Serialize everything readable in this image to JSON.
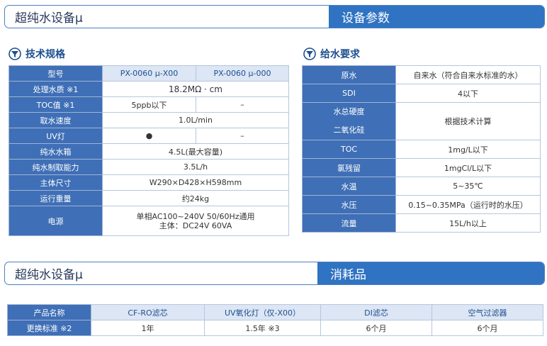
{
  "banner1": {
    "left": "超纯水设备μ",
    "right": "设备参数"
  },
  "spec": {
    "heading": "技术规格",
    "header": [
      "型号",
      "PX-0060 μ-X00",
      "PX-0060 μ-000"
    ],
    "rows": [
      {
        "label": "处理水质 ※1",
        "span": "18.2MΩ · cm"
      },
      {
        "label": "TOC值 ※1",
        "c1": "5ppb以下",
        "c2": "–"
      },
      {
        "label": "取水速度",
        "span": "1.0L/min"
      },
      {
        "label": "UV灯",
        "c1": "●",
        "c2": "–"
      },
      {
        "label": "纯水水箱",
        "span": "4.5L(最大容量)"
      },
      {
        "label": "纯水制取能力",
        "span": "3.5L/h"
      },
      {
        "label": "主体尺寸",
        "span": "W290×D428×H598mm"
      },
      {
        "label": "运行重量",
        "span": "约24kg"
      },
      {
        "label": "电源",
        "span_line1": "单相AC100~240V 50/60Hz通用",
        "span_line2": "主体：DC24V 60VA"
      }
    ]
  },
  "feed": {
    "heading": "给水要求",
    "rows": [
      {
        "label": "原水",
        "value": "自来水（符合自来水标准的水）"
      },
      {
        "label": "SDI",
        "value": "4以下"
      },
      {
        "label": "水总硬度",
        "label2": "二氧化硅",
        "value": "根据技术计算"
      },
      {
        "label": "TOC",
        "value": "1mg/L以下"
      },
      {
        "label": "氯残留",
        "value": "1mgCl/L以下"
      },
      {
        "label": "水温",
        "value": "5~35℃"
      },
      {
        "label": "水压",
        "value": "0.15~0.35MPa（运行时的水压）"
      },
      {
        "label": "流量",
        "value": "15L/h以上"
      }
    ]
  },
  "banner2": {
    "left": "超纯水设备μ",
    "right": "消耗品"
  },
  "consumables": {
    "header": [
      "产品名称",
      "CF-RO滤芯",
      "UV氧化灯（仅-X00）",
      "DI滤芯",
      "空气过滤器"
    ],
    "row": [
      "更换标准 ※2",
      "1年",
      "1.5年 ※3",
      "6个月",
      "6个月"
    ]
  },
  "colors": {
    "accent": "#2f73c2",
    "label_bg": "#3f6fb6",
    "header_bg": "#dce6f4"
  },
  "icons": {
    "section": "filter-funnel-icon"
  }
}
